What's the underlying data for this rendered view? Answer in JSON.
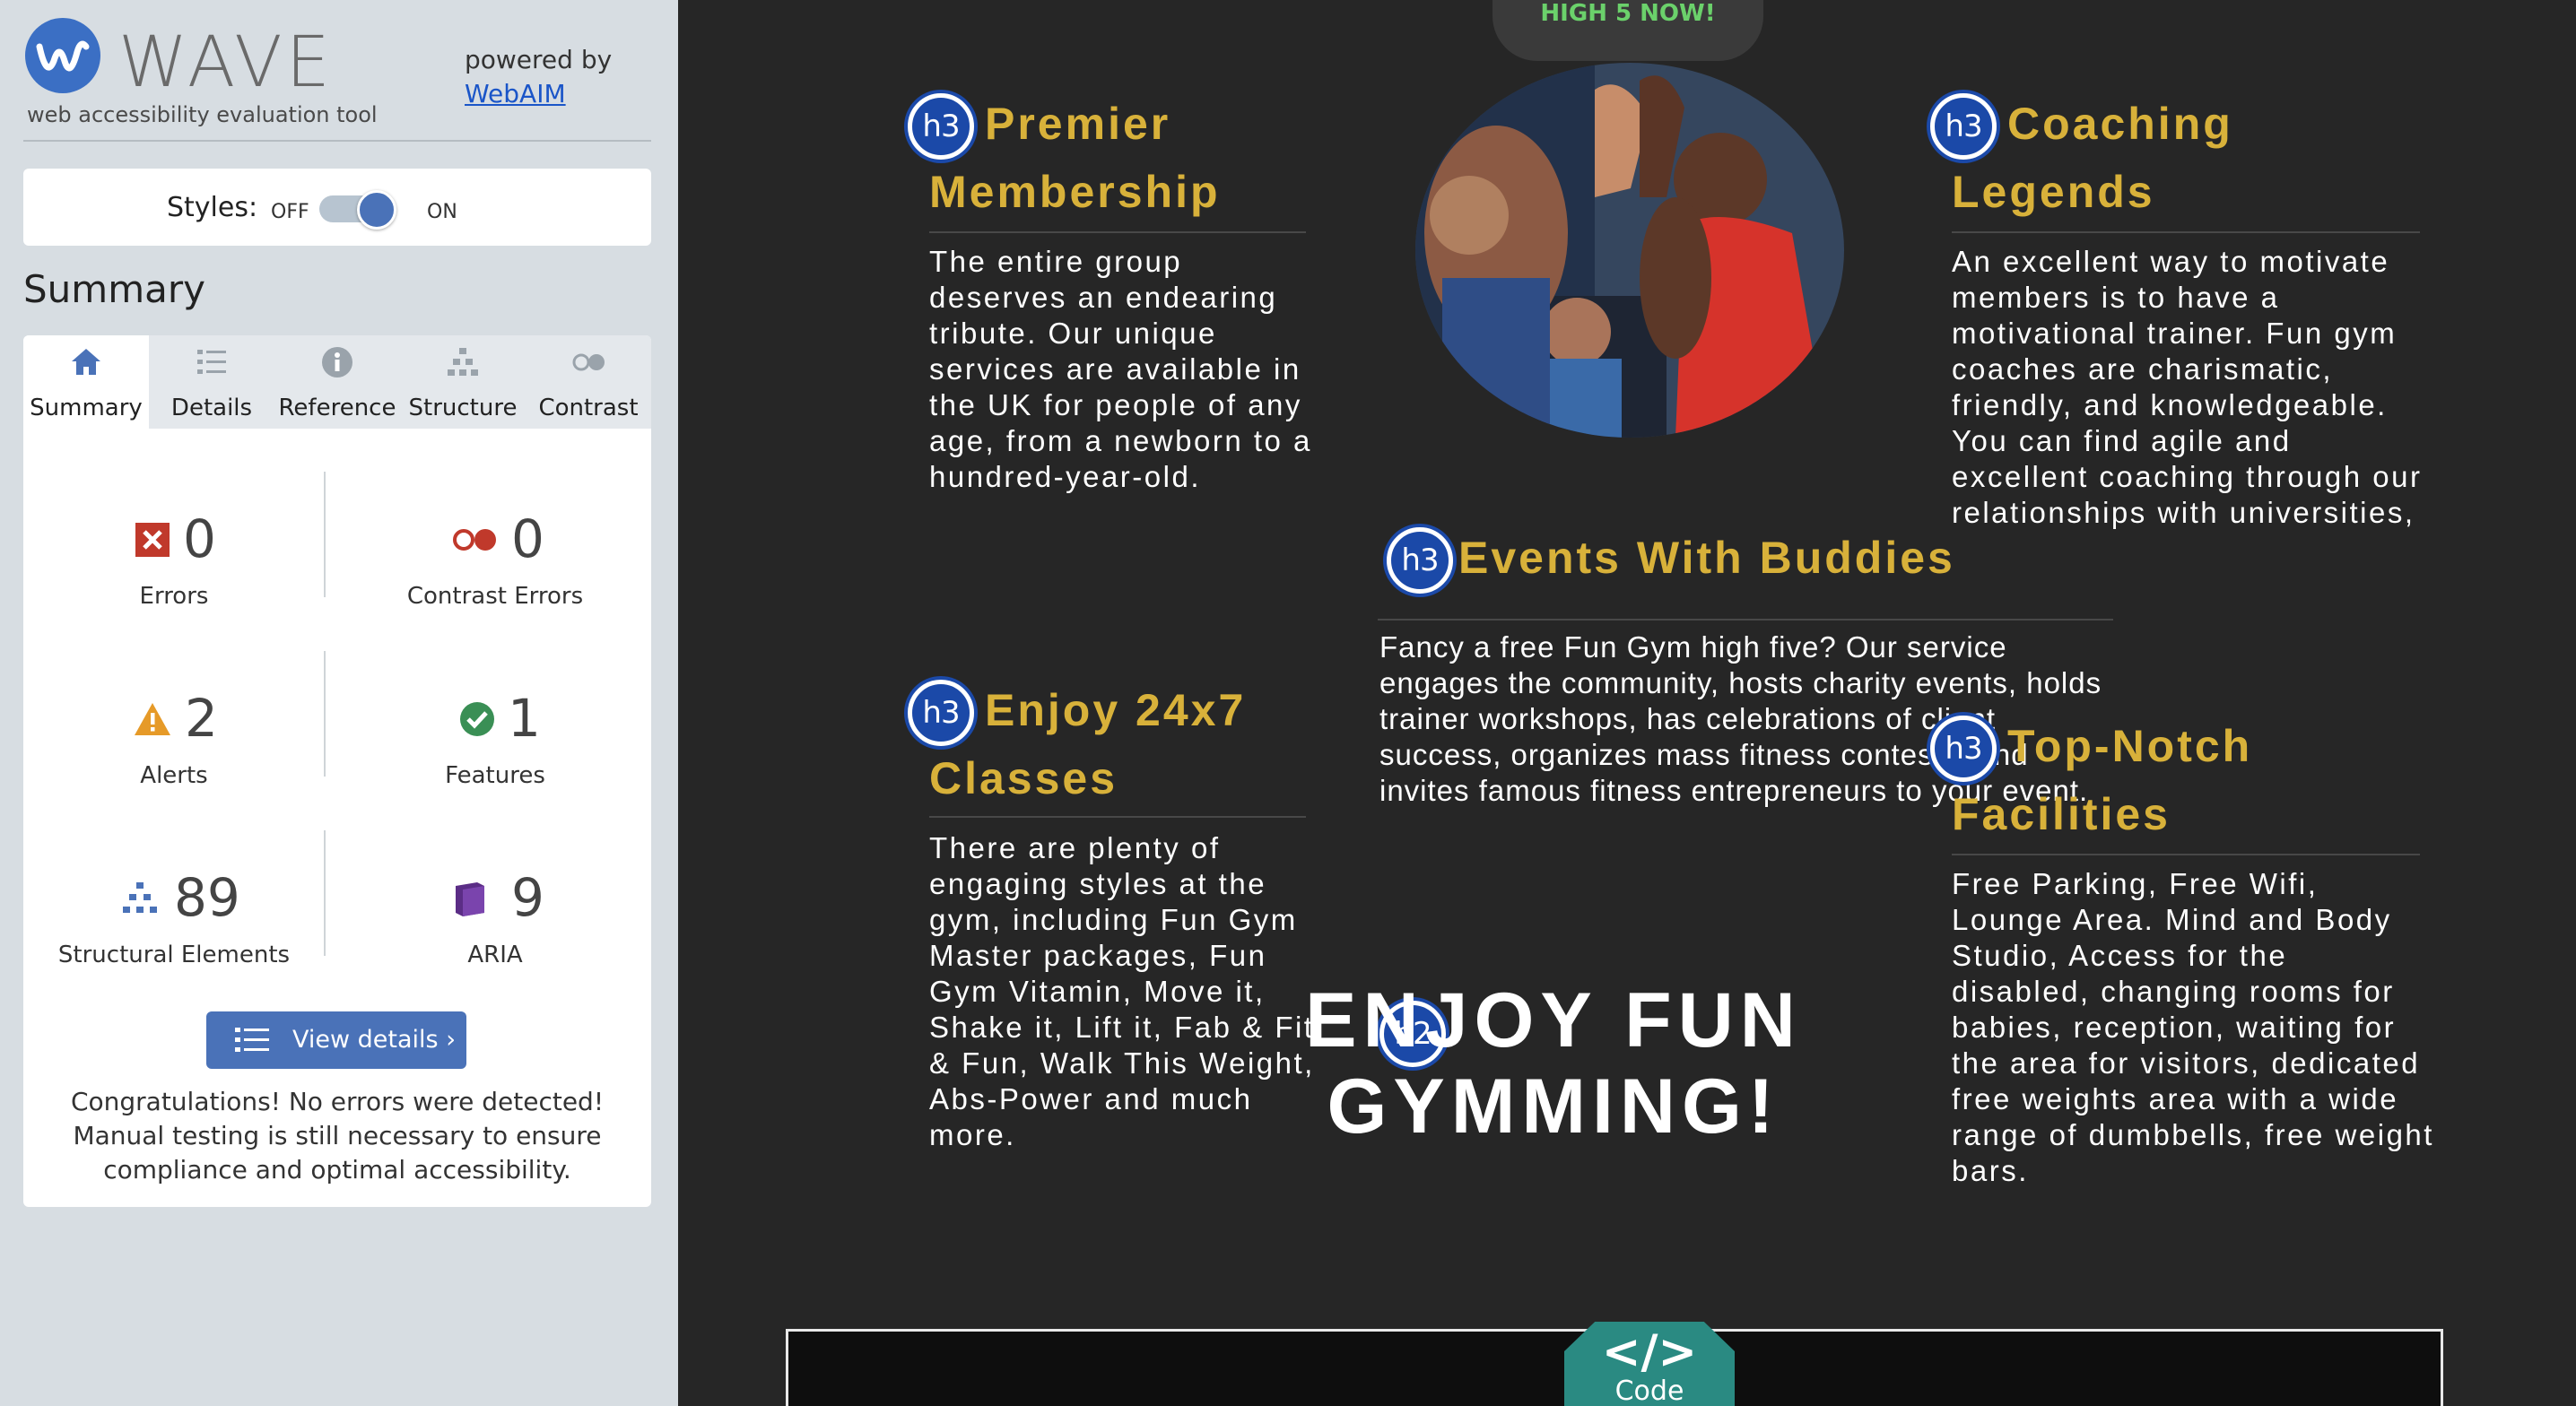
{
  "wave": {
    "title": "WAVE",
    "subtitle": "web accessibility evaluation tool",
    "powered_by": "powered by",
    "webaim_link": "WebAIM",
    "styles_label": "Styles:",
    "styles_off": "OFF",
    "styles_on": "ON",
    "styles_state": "on",
    "summary_heading": "Summary",
    "tabs": [
      {
        "label": "Summary",
        "icon": "home-icon",
        "active": true
      },
      {
        "label": "Details",
        "icon": "list-icon",
        "active": false
      },
      {
        "label": "Reference",
        "icon": "info-icon",
        "active": false
      },
      {
        "label": "Structure",
        "icon": "structure-icon",
        "active": false
      },
      {
        "label": "Contrast",
        "icon": "contrast-icon",
        "active": false
      }
    ],
    "stats": {
      "errors": {
        "count": "0",
        "label": "Errors",
        "icon": "error-icon",
        "color": "#c0392b"
      },
      "contrast_errors": {
        "count": "0",
        "label": "Contrast Errors",
        "icon": "contrast-error-icon",
        "color": "#c0392b"
      },
      "alerts": {
        "count": "2",
        "label": "Alerts",
        "icon": "alert-icon",
        "color": "#e69a28"
      },
      "features": {
        "count": "1",
        "label": "Features",
        "icon": "feature-icon",
        "color": "#3a8f55"
      },
      "structural": {
        "count": "89",
        "label": "Structural Elements",
        "icon": "structure-icon",
        "color": "#4a72b8"
      },
      "aria": {
        "count": "9",
        "label": "ARIA",
        "icon": "aria-icon",
        "color": "#5b2d86"
      }
    },
    "view_details_label": "View details ›",
    "congrats_text": "Congratulations! No errors were detected! Manual testing is still necessary to ensure compliance and optimal accessibility."
  },
  "page": {
    "high5_label": "HIGH 5 NOW!",
    "h3_badge": "h3",
    "h2_badge": "h2",
    "premier": {
      "title": "Premier Membership",
      "body": "The entire group deserves an endearing tribute. Our unique services are available in the UK for people of any age, from a newborn to a hundred-year-old."
    },
    "coaching": {
      "title": "Coaching Legends",
      "body": "An excellent way to motivate members is to have a motivational trainer. Fun gym coaches are charismatic, friendly, and knowledgeable. You can find agile and excellent coaching through our relationships with universities,"
    },
    "events": {
      "title": "Events With Buddies",
      "body": "Fancy a free Fun Gym high five? Our service engages the community, hosts charity events, holds trainer workshops, has celebrations of client success, organizes mass fitness contests, and invites famous fitness entrepreneurs to your event."
    },
    "enjoy": {
      "title": "Enjoy 24x7 Classes",
      "body": "There are plenty of engaging styles at the gym, including Fun Gym Master packages, Fun Gym Vitamin, Move it, Shake it, Lift it, Fab & Fit & Fun, Walk This Weight, Abs-Power and much more."
    },
    "facilities": {
      "title": "Top-Notch Facilities",
      "body": "Free Parking, Free Wifi, Lounge Area. Mind and Body Studio, Access for the disabled, changing rooms for babies, reception, waiting for the area for visitors, dedicated free weights area with a wide range of dumbbells, free weight bars."
    },
    "h2_title": "ENJOY FUN GYMMING!",
    "code_symbol": "</>",
    "code_label": "Code"
  }
}
